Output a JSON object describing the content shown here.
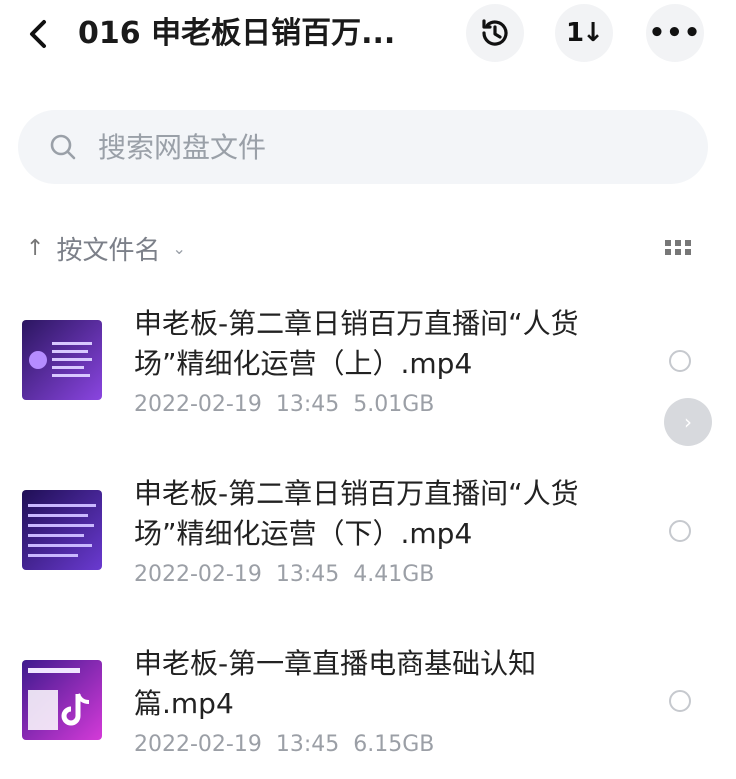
{
  "header": {
    "title": "016 申老板日销百万...",
    "back_icon": "chevron-left-icon",
    "history_icon": "history-icon",
    "sort_icon": "sort-updown-icon",
    "sort_glyph": "1↓",
    "more_icon": "more-horizontal-icon",
    "more_glyph": "•••"
  },
  "search": {
    "placeholder": "搜索网盘文件",
    "icon": "search-icon"
  },
  "sortbar": {
    "arrow": "↑",
    "label": "按文件名",
    "chevron": "⌄",
    "view_icon": "grid-view-icon"
  },
  "files": [
    {
      "name": "申老板-第二章日销百万直播间“人货场”精细化运营（上）.mp4",
      "date": "2022-02-19",
      "time": "13:45",
      "size": "5.01GB",
      "thumb_colors": [
        "#3a1c7a",
        "#7b3fd0"
      ]
    },
    {
      "name": "申老板-第二章日销百万直播间“人货场”精细化运营（下）.mp4",
      "date": "2022-02-19",
      "time": "13:45",
      "size": "4.41GB",
      "thumb_colors": [
        "#2a1670",
        "#6b3cc8"
      ]
    },
    {
      "name": "申老板-第一章直播电商基础认知篇.mp4",
      "date": "2022-02-19",
      "time": "13:45",
      "size": "6.15GB",
      "thumb_colors": [
        "#4a1c9a",
        "#c23ad6"
      ]
    }
  ],
  "scroll_handle_glyph": "›",
  "colors": {
    "accent_bg": "#f3f5f8",
    "meta_text": "#9b9fa6"
  }
}
